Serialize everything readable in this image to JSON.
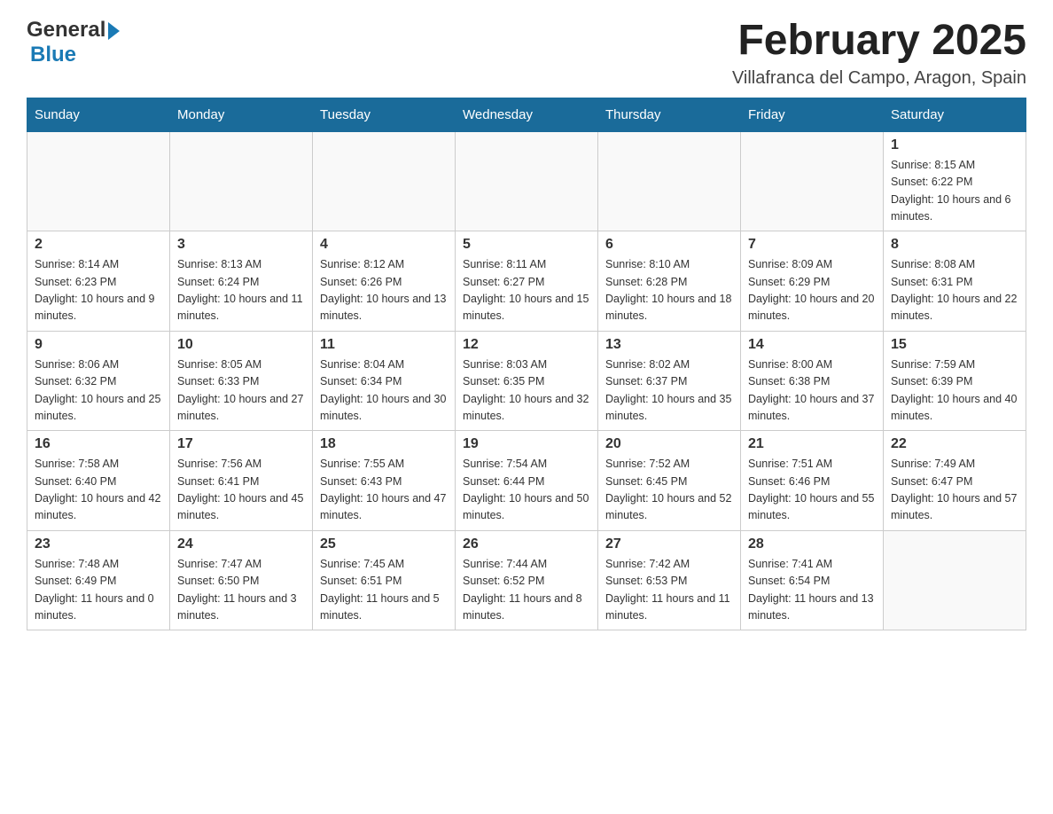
{
  "header": {
    "logo_general": "General",
    "logo_blue": "Blue",
    "month_title": "February 2025",
    "location": "Villafranca del Campo, Aragon, Spain"
  },
  "days_of_week": [
    "Sunday",
    "Monday",
    "Tuesday",
    "Wednesday",
    "Thursday",
    "Friday",
    "Saturday"
  ],
  "weeks": [
    {
      "days": [
        {
          "number": "",
          "sunrise": "",
          "sunset": "",
          "daylight": "",
          "empty": true
        },
        {
          "number": "",
          "sunrise": "",
          "sunset": "",
          "daylight": "",
          "empty": true
        },
        {
          "number": "",
          "sunrise": "",
          "sunset": "",
          "daylight": "",
          "empty": true
        },
        {
          "number": "",
          "sunrise": "",
          "sunset": "",
          "daylight": "",
          "empty": true
        },
        {
          "number": "",
          "sunrise": "",
          "sunset": "",
          "daylight": "",
          "empty": true
        },
        {
          "number": "",
          "sunrise": "",
          "sunset": "",
          "daylight": "",
          "empty": true
        },
        {
          "number": "1",
          "sunrise": "Sunrise: 8:15 AM",
          "sunset": "Sunset: 6:22 PM",
          "daylight": "Daylight: 10 hours and 6 minutes.",
          "empty": false
        }
      ]
    },
    {
      "days": [
        {
          "number": "2",
          "sunrise": "Sunrise: 8:14 AM",
          "sunset": "Sunset: 6:23 PM",
          "daylight": "Daylight: 10 hours and 9 minutes.",
          "empty": false
        },
        {
          "number": "3",
          "sunrise": "Sunrise: 8:13 AM",
          "sunset": "Sunset: 6:24 PM",
          "daylight": "Daylight: 10 hours and 11 minutes.",
          "empty": false
        },
        {
          "number": "4",
          "sunrise": "Sunrise: 8:12 AM",
          "sunset": "Sunset: 6:26 PM",
          "daylight": "Daylight: 10 hours and 13 minutes.",
          "empty": false
        },
        {
          "number": "5",
          "sunrise": "Sunrise: 8:11 AM",
          "sunset": "Sunset: 6:27 PM",
          "daylight": "Daylight: 10 hours and 15 minutes.",
          "empty": false
        },
        {
          "number": "6",
          "sunrise": "Sunrise: 8:10 AM",
          "sunset": "Sunset: 6:28 PM",
          "daylight": "Daylight: 10 hours and 18 minutes.",
          "empty": false
        },
        {
          "number": "7",
          "sunrise": "Sunrise: 8:09 AM",
          "sunset": "Sunset: 6:29 PM",
          "daylight": "Daylight: 10 hours and 20 minutes.",
          "empty": false
        },
        {
          "number": "8",
          "sunrise": "Sunrise: 8:08 AM",
          "sunset": "Sunset: 6:31 PM",
          "daylight": "Daylight: 10 hours and 22 minutes.",
          "empty": false
        }
      ]
    },
    {
      "days": [
        {
          "number": "9",
          "sunrise": "Sunrise: 8:06 AM",
          "sunset": "Sunset: 6:32 PM",
          "daylight": "Daylight: 10 hours and 25 minutes.",
          "empty": false
        },
        {
          "number": "10",
          "sunrise": "Sunrise: 8:05 AM",
          "sunset": "Sunset: 6:33 PM",
          "daylight": "Daylight: 10 hours and 27 minutes.",
          "empty": false
        },
        {
          "number": "11",
          "sunrise": "Sunrise: 8:04 AM",
          "sunset": "Sunset: 6:34 PM",
          "daylight": "Daylight: 10 hours and 30 minutes.",
          "empty": false
        },
        {
          "number": "12",
          "sunrise": "Sunrise: 8:03 AM",
          "sunset": "Sunset: 6:35 PM",
          "daylight": "Daylight: 10 hours and 32 minutes.",
          "empty": false
        },
        {
          "number": "13",
          "sunrise": "Sunrise: 8:02 AM",
          "sunset": "Sunset: 6:37 PM",
          "daylight": "Daylight: 10 hours and 35 minutes.",
          "empty": false
        },
        {
          "number": "14",
          "sunrise": "Sunrise: 8:00 AM",
          "sunset": "Sunset: 6:38 PM",
          "daylight": "Daylight: 10 hours and 37 minutes.",
          "empty": false
        },
        {
          "number": "15",
          "sunrise": "Sunrise: 7:59 AM",
          "sunset": "Sunset: 6:39 PM",
          "daylight": "Daylight: 10 hours and 40 minutes.",
          "empty": false
        }
      ]
    },
    {
      "days": [
        {
          "number": "16",
          "sunrise": "Sunrise: 7:58 AM",
          "sunset": "Sunset: 6:40 PM",
          "daylight": "Daylight: 10 hours and 42 minutes.",
          "empty": false
        },
        {
          "number": "17",
          "sunrise": "Sunrise: 7:56 AM",
          "sunset": "Sunset: 6:41 PM",
          "daylight": "Daylight: 10 hours and 45 minutes.",
          "empty": false
        },
        {
          "number": "18",
          "sunrise": "Sunrise: 7:55 AM",
          "sunset": "Sunset: 6:43 PM",
          "daylight": "Daylight: 10 hours and 47 minutes.",
          "empty": false
        },
        {
          "number": "19",
          "sunrise": "Sunrise: 7:54 AM",
          "sunset": "Sunset: 6:44 PM",
          "daylight": "Daylight: 10 hours and 50 minutes.",
          "empty": false
        },
        {
          "number": "20",
          "sunrise": "Sunrise: 7:52 AM",
          "sunset": "Sunset: 6:45 PM",
          "daylight": "Daylight: 10 hours and 52 minutes.",
          "empty": false
        },
        {
          "number": "21",
          "sunrise": "Sunrise: 7:51 AM",
          "sunset": "Sunset: 6:46 PM",
          "daylight": "Daylight: 10 hours and 55 minutes.",
          "empty": false
        },
        {
          "number": "22",
          "sunrise": "Sunrise: 7:49 AM",
          "sunset": "Sunset: 6:47 PM",
          "daylight": "Daylight: 10 hours and 57 minutes.",
          "empty": false
        }
      ]
    },
    {
      "days": [
        {
          "number": "23",
          "sunrise": "Sunrise: 7:48 AM",
          "sunset": "Sunset: 6:49 PM",
          "daylight": "Daylight: 11 hours and 0 minutes.",
          "empty": false
        },
        {
          "number": "24",
          "sunrise": "Sunrise: 7:47 AM",
          "sunset": "Sunset: 6:50 PM",
          "daylight": "Daylight: 11 hours and 3 minutes.",
          "empty": false
        },
        {
          "number": "25",
          "sunrise": "Sunrise: 7:45 AM",
          "sunset": "Sunset: 6:51 PM",
          "daylight": "Daylight: 11 hours and 5 minutes.",
          "empty": false
        },
        {
          "number": "26",
          "sunrise": "Sunrise: 7:44 AM",
          "sunset": "Sunset: 6:52 PM",
          "daylight": "Daylight: 11 hours and 8 minutes.",
          "empty": false
        },
        {
          "number": "27",
          "sunrise": "Sunrise: 7:42 AM",
          "sunset": "Sunset: 6:53 PM",
          "daylight": "Daylight: 11 hours and 11 minutes.",
          "empty": false
        },
        {
          "number": "28",
          "sunrise": "Sunrise: 7:41 AM",
          "sunset": "Sunset: 6:54 PM",
          "daylight": "Daylight: 11 hours and 13 minutes.",
          "empty": false
        },
        {
          "number": "",
          "sunrise": "",
          "sunset": "",
          "daylight": "",
          "empty": true
        }
      ]
    }
  ]
}
